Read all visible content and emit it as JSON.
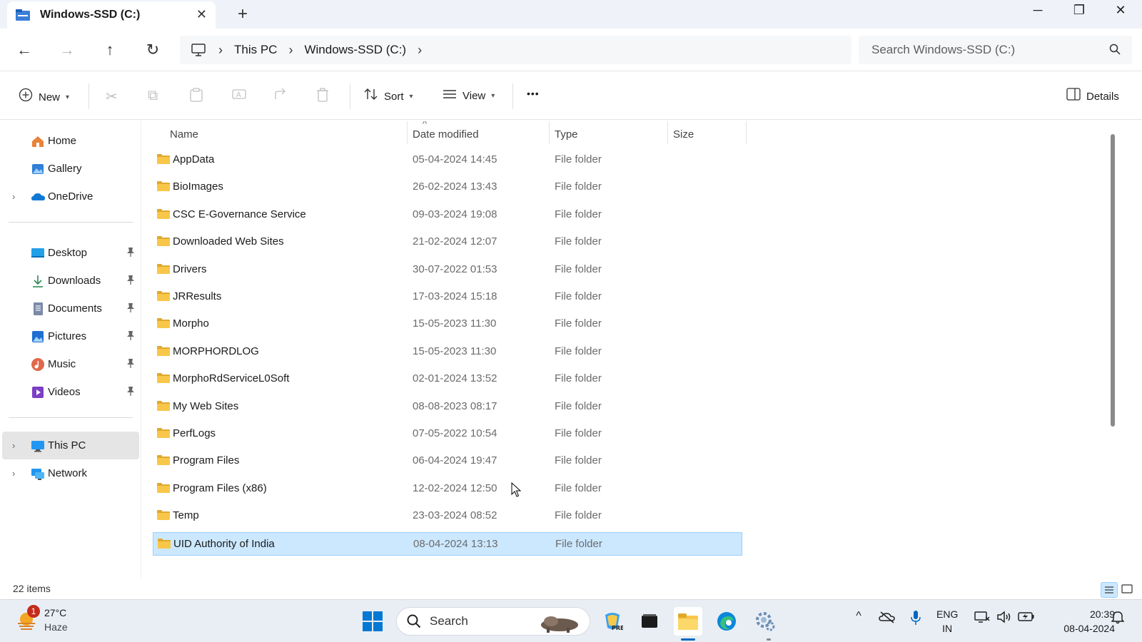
{
  "window": {
    "tab_title": "Windows-SSD (C:)",
    "close_tab_glyph": "✕",
    "new_tab_glyph": "+",
    "minimize_glyph": "─",
    "restore_glyph": "❐",
    "close_glyph": "✕"
  },
  "nav": {
    "back_glyph": "←",
    "forward_glyph": "→",
    "up_glyph": "↑",
    "refresh_glyph": "↻"
  },
  "address": {
    "crumbs": [
      "This PC",
      "Windows-SSD (C:)"
    ],
    "separator": "›"
  },
  "search": {
    "placeholder": "Search Windows-SSD (C:)"
  },
  "commands": {
    "new_label": "New",
    "sort_label": "Sort",
    "view_label": "View",
    "more_label": "•••",
    "details_label": "Details",
    "cut_glyph": "✂",
    "copy_glyph": "⧉",
    "paste_glyph": "📋",
    "rename_glyph": "Ⓐ",
    "share_glyph": "⇪",
    "delete_glyph": "🗑"
  },
  "sidebar": {
    "items": [
      {
        "label": "Home",
        "icon": "home-icon"
      },
      {
        "label": "Gallery",
        "icon": "gallery-icon"
      },
      {
        "label": "OneDrive",
        "icon": "onedrive-icon"
      },
      {
        "label": "Desktop",
        "icon": "desktop-icon"
      },
      {
        "label": "Downloads",
        "icon": "downloads-icon"
      },
      {
        "label": "Documents",
        "icon": "documents-icon"
      },
      {
        "label": "Pictures",
        "icon": "pictures-icon"
      },
      {
        "label": "Music",
        "icon": "music-icon"
      },
      {
        "label": "Videos",
        "icon": "videos-icon"
      },
      {
        "label": "This PC",
        "icon": "this-pc-icon"
      },
      {
        "label": "Network",
        "icon": "network-icon"
      }
    ],
    "expand_glyph": "›",
    "pin_glyph": "📌"
  },
  "columns": {
    "name": "Name",
    "date": "Date modified",
    "type": "Type",
    "size": "Size",
    "sort_glyph": "^"
  },
  "files": [
    {
      "name": "AppData",
      "date": "05-04-2024 14:45",
      "type": "File folder"
    },
    {
      "name": "BioImages",
      "date": "26-02-2024 13:43",
      "type": "File folder"
    },
    {
      "name": "CSC E-Governance Service",
      "date": "09-03-2024 19:08",
      "type": "File folder"
    },
    {
      "name": "Downloaded Web Sites",
      "date": "21-02-2024 12:07",
      "type": "File folder"
    },
    {
      "name": "Drivers",
      "date": "30-07-2022 01:53",
      "type": "File folder"
    },
    {
      "name": "JRResults",
      "date": "17-03-2024 15:18",
      "type": "File folder"
    },
    {
      "name": "Morpho",
      "date": "15-05-2023 11:30",
      "type": "File folder"
    },
    {
      "name": "MORPHORDLOG",
      "date": "15-05-2023 11:30",
      "type": "File folder"
    },
    {
      "name": "MorphoRdServiceL0Soft",
      "date": "02-01-2024 13:52",
      "type": "File folder"
    },
    {
      "name": "My Web Sites",
      "date": "08-08-2023 08:17",
      "type": "File folder"
    },
    {
      "name": "PerfLogs",
      "date": "07-05-2022 10:54",
      "type": "File folder"
    },
    {
      "name": "Program Files",
      "date": "06-04-2024 19:47",
      "type": "File folder"
    },
    {
      "name": "Program Files (x86)",
      "date": "12-02-2024 12:50",
      "type": "File folder"
    },
    {
      "name": "Temp",
      "date": "23-03-2024 08:52",
      "type": "File folder"
    },
    {
      "name": "UID Authority of India",
      "date": "08-04-2024 13:13",
      "type": "File folder"
    }
  ],
  "status": {
    "item_count": "22 items"
  },
  "taskbar": {
    "weather_temp": "27°C",
    "weather_condition": "Haze",
    "weather_badge": "1",
    "search_label": "Search",
    "lang_line1": "ENG",
    "lang_line2": "IN",
    "time": "20:39",
    "date": "08-04-2024",
    "chevron_glyph": "^"
  },
  "colors": {
    "accent": "#0067c0",
    "selection_bg": "#cce8ff",
    "folder_yellow": "#f8c74a"
  }
}
